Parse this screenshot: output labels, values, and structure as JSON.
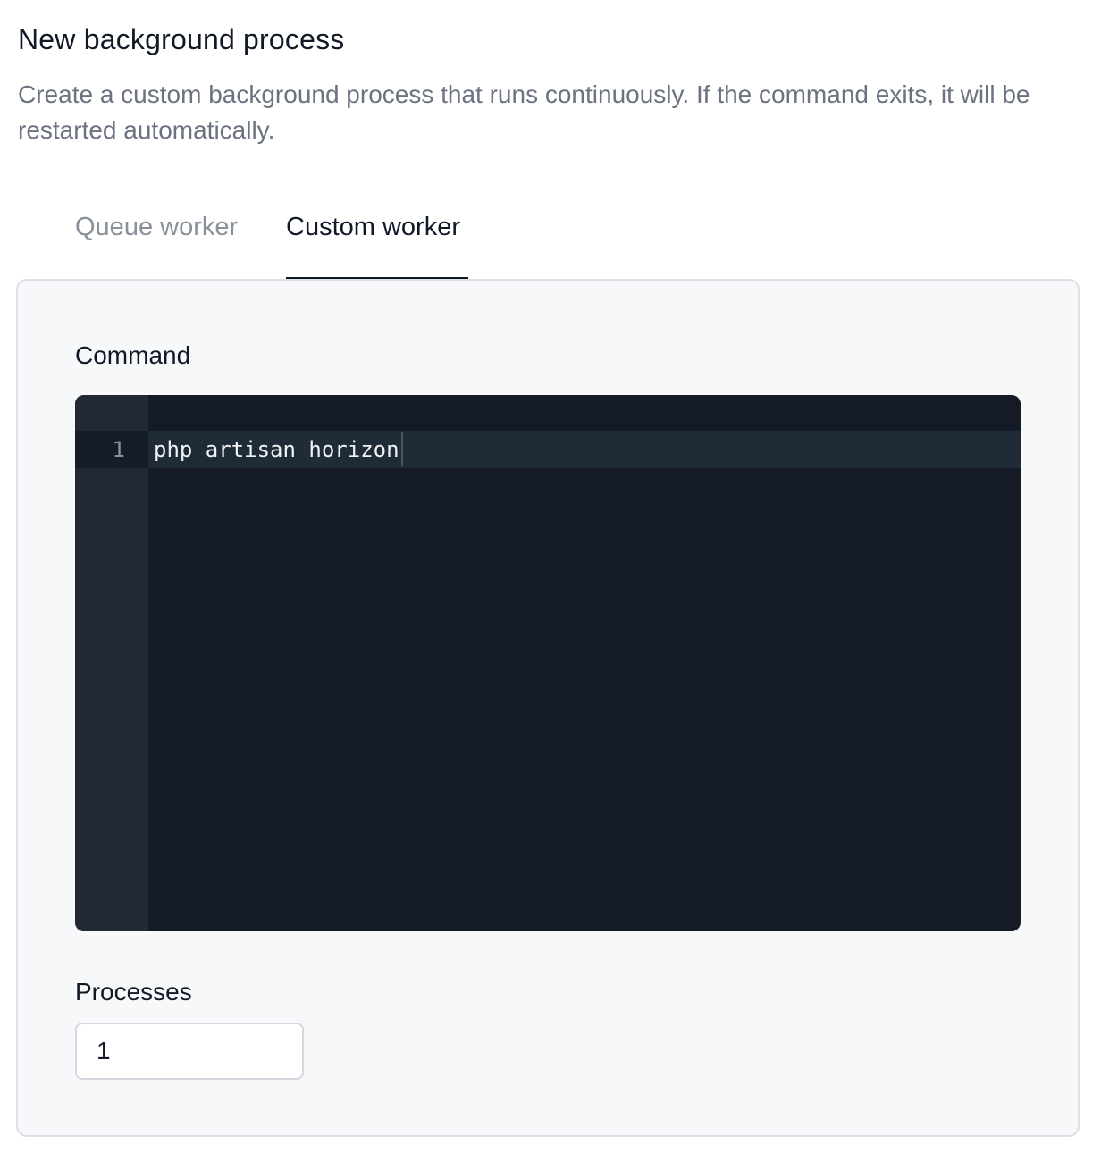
{
  "header": {
    "title": "New background process",
    "description": "Create a custom background process that runs continuously. If the command exits, it will be restarted automatically."
  },
  "tabs": [
    {
      "label": "Queue worker",
      "active": false
    },
    {
      "label": "Custom worker",
      "active": true
    }
  ],
  "form": {
    "command": {
      "label": "Command",
      "line_number": "1",
      "value": "php artisan horizon"
    },
    "processes": {
      "label": "Processes",
      "value": "1"
    }
  },
  "colors": {
    "editor_background": "#141a26",
    "editor_gutter": "#222935",
    "active_tab_underline": "#111827",
    "card_background": "#f7f8fa"
  }
}
